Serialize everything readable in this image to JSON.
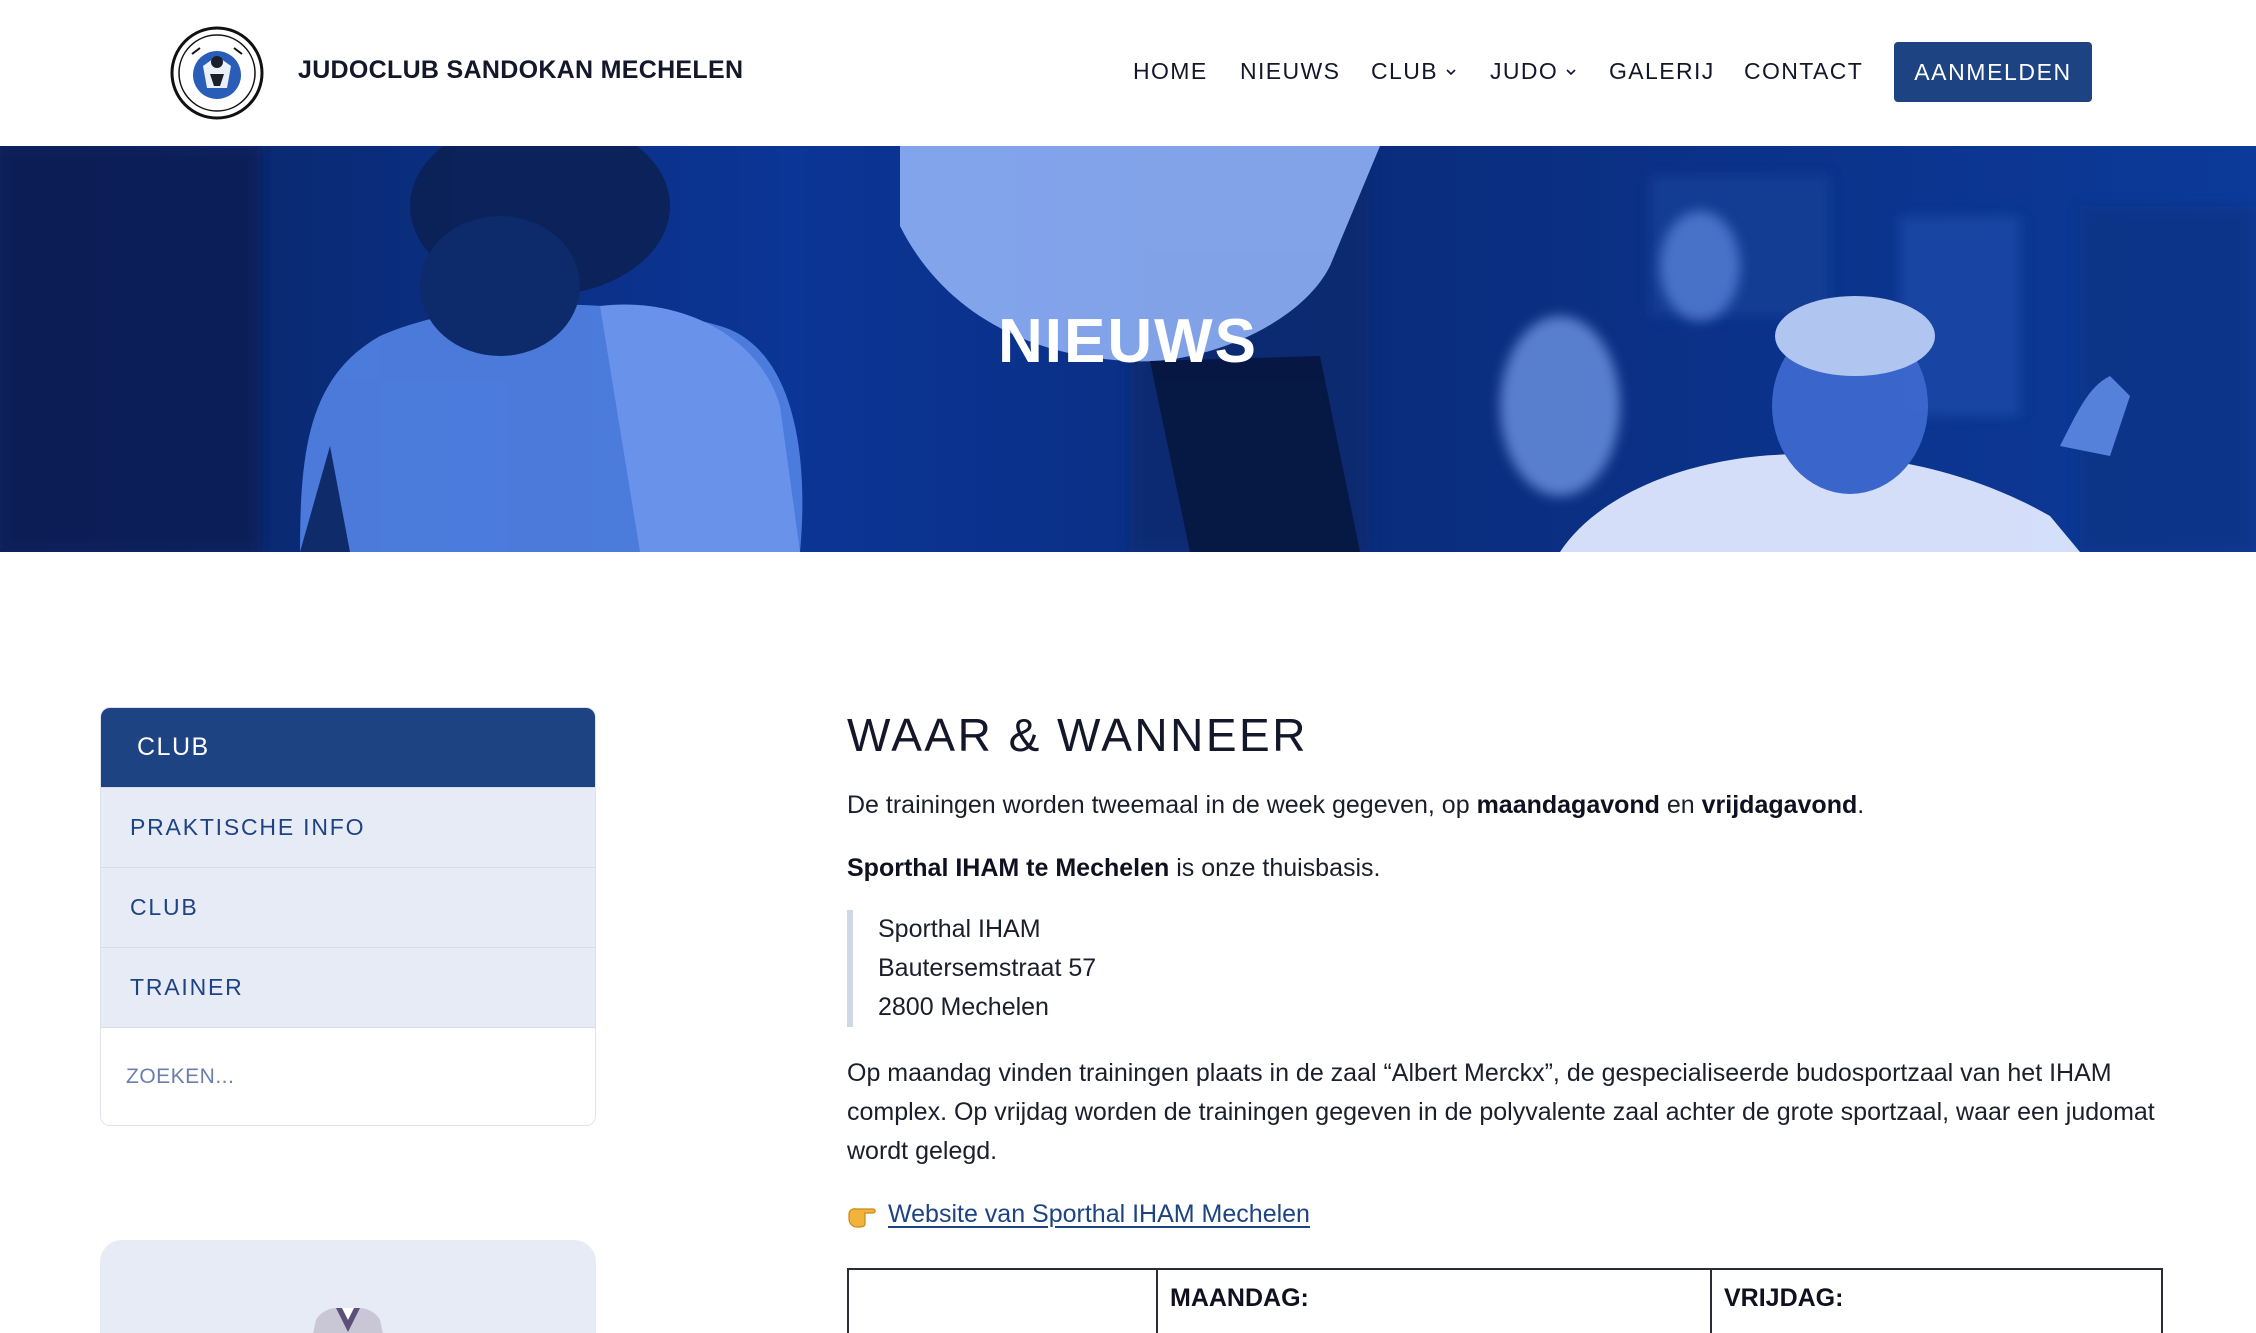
{
  "header": {
    "brand": "JUDOCLUB SANDOKAN MECHELEN",
    "logo_icon": "club-logo-icon",
    "nav": [
      {
        "label": "HOME",
        "dropdown": false
      },
      {
        "label": "NIEUWS",
        "dropdown": false
      },
      {
        "label": "CLUB",
        "dropdown": true
      },
      {
        "label": "JUDO",
        "dropdown": true
      },
      {
        "label": "GALERIJ",
        "dropdown": false
      },
      {
        "label": "CONTACT",
        "dropdown": false
      }
    ],
    "cta_label": "AANMELDEN"
  },
  "hero": {
    "title": "NIEUWS"
  },
  "sidebar": {
    "heading": "CLUB",
    "items": [
      {
        "label": "PRAKTISCHE INFO"
      },
      {
        "label": "CLUB"
      },
      {
        "label": "TRAINER"
      }
    ],
    "search_placeholder": "ZOEKEN..."
  },
  "content": {
    "title": "WAAR & WANNEER",
    "intro_pre": "De trainingen worden tweemaal in de week gegeven, op ",
    "intro_bold1": "maandagavond",
    "intro_mid": " en ",
    "intro_bold2": "vrijdagavond",
    "intro_post": ".",
    "location_bold": "Sporthal IHAM te Mechelen",
    "location_rest": " is onze thuisbasis.",
    "address": [
      "Sporthal IHAM",
      "Bautersemstraat 57",
      "2800 Mechelen"
    ],
    "details": "Op maandag vinden trainingen plaats in de zaal “Albert Merckx”, de gespecialiseerde budosportzaal van het IHAM complex. Op vrijdag worden de trainingen gegeven in de polyvalente zaal achter de grote sportzaal, waar een judomat wordt gelegd.",
    "link_icon": "pointing-hand-icon",
    "link_label": "Website van Sporthal IHAM Mechelen",
    "table_headers": [
      "",
      "MAANDAG:",
      "VRIJDAG:"
    ]
  },
  "colors": {
    "brand_blue": "#1d4383",
    "sidebar_bg": "#e7ebf6",
    "hero_overlay": "#0a2f86"
  }
}
